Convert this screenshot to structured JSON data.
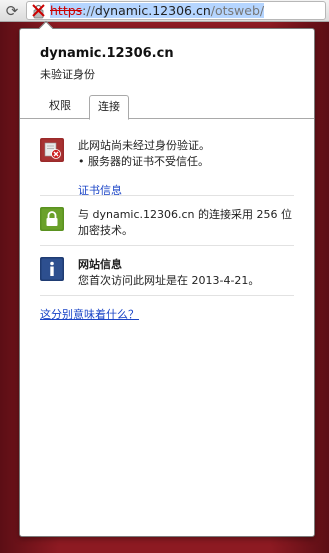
{
  "address_bar": {
    "scheme": "https",
    "separator": "://",
    "host": "dynamic.12306.cn",
    "path": "/otsweb/"
  },
  "popup": {
    "site_title": "dynamic.12306.cn",
    "site_subtitle": "未验证身份",
    "tabs": [
      {
        "label": "权限"
      },
      {
        "label": "连接"
      }
    ],
    "identity": {
      "line1": "此网站尚未经过身份验证。",
      "bullet": "• 服务器的证书不受信任。",
      "cert_link": "证书信息"
    },
    "connection": {
      "text": "与 dynamic.12306.cn 的连接采用 256 位加密技术。"
    },
    "site_info": {
      "heading": "网站信息",
      "text": "您首次访问此网址是在 2013-4-21。"
    },
    "help_link": "这分别意味着什么？"
  },
  "colors": {
    "background_red": "#8d1a22",
    "link_blue": "#1a44c7",
    "error_red": "#cc0000",
    "lock_green": "#6aa12a",
    "info_blue": "#2d4f8f"
  },
  "icons": {
    "reload": "reload-icon",
    "insecure": "insecure-lock-icon",
    "identity": "identity-error-icon",
    "connection": "lock-icon",
    "info": "info-icon"
  }
}
